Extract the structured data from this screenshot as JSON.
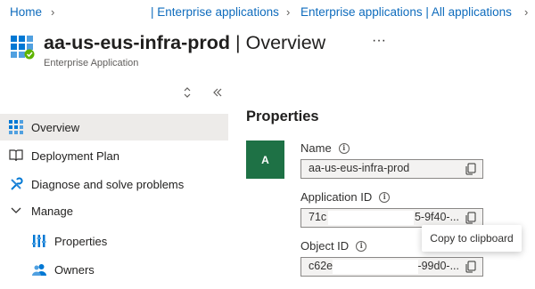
{
  "breadcrumb": {
    "items": [
      "Home",
      "| Enterprise applications",
      "Enterprise applications | All applications"
    ]
  },
  "header": {
    "app_name": "aa-us-eus-infra-prod",
    "page_suffix": " | Overview",
    "more_label": "···",
    "subtitle": "Enterprise Application"
  },
  "sidebar": {
    "items": [
      {
        "label": "Overview",
        "icon": "grid-icon",
        "active": true
      },
      {
        "label": "Deployment Plan",
        "icon": "book-icon"
      },
      {
        "label": "Diagnose and solve problems",
        "icon": "wrench-icon"
      },
      {
        "label": "Manage",
        "icon": "chevron-down-icon"
      },
      {
        "label": "Properties",
        "icon": "properties-icon"
      },
      {
        "label": "Owners",
        "icon": "owners-icon"
      }
    ]
  },
  "properties": {
    "title": "Properties",
    "avatar_letter": "A",
    "name_label": "Name",
    "name_value": "aa-us-eus-infra-prod",
    "appid_label": "Application ID",
    "appid_value_start": "71c",
    "appid_value_end": "5-9f40-...",
    "objid_label": "Object ID",
    "objid_value_start": "c62e",
    "objid_value_end": "-99d0-..."
  },
  "tooltip": {
    "text": "Copy to clipboard"
  },
  "colors": {
    "accent": "#0f6cbd",
    "avatar": "#1e7145",
    "active_nav": "#edebe9"
  }
}
